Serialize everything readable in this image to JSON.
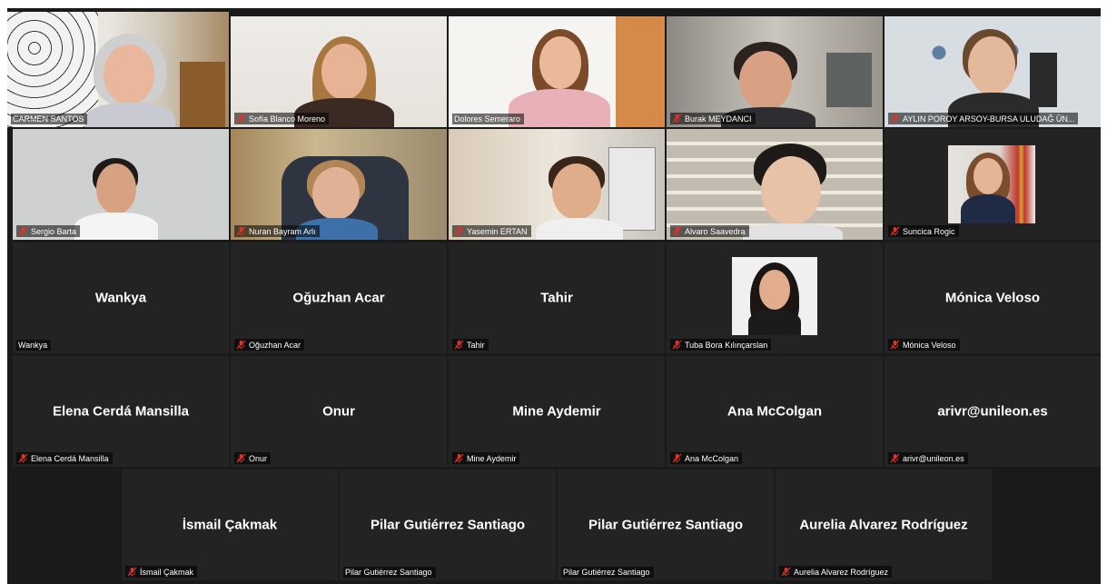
{
  "participants": [
    {
      "name": "CARMEN SANTOS",
      "muted": false,
      "video": true,
      "active": true
    },
    {
      "name": "Sofía Blanco Moreno",
      "muted": true,
      "video": true
    },
    {
      "name": "Dolores Semeraro",
      "muted": false,
      "video": true
    },
    {
      "name": "Burak MEYDANCI",
      "muted": true,
      "video": true
    },
    {
      "name": "AYLIN POROY ARSOY-BURSA ULUDAĞ ÜN...",
      "muted": true,
      "video": true
    },
    {
      "name": "Sergio Barta",
      "muted": true,
      "video": true
    },
    {
      "name": "Nuran Bayram Arlı",
      "muted": true,
      "video": true
    },
    {
      "name": "Yasemin ERTAN",
      "muted": true,
      "video": true
    },
    {
      "name": "Alvaro Saavedra",
      "muted": true,
      "video": true
    },
    {
      "name": "Suncica Rogic",
      "muted": true,
      "video": true
    },
    {
      "name": "Wankya",
      "display": "Wankya",
      "muted": false,
      "video": false
    },
    {
      "name": "Oğuzhan Acar",
      "display": "Oğuzhan Acar",
      "muted": true,
      "video": false
    },
    {
      "name": "Tahir",
      "display": "Tahir",
      "muted": true,
      "video": false
    },
    {
      "name": "Tuba Bora Kılınçarslan",
      "muted": true,
      "video": false,
      "photo": true
    },
    {
      "name": "Mónica Veloso",
      "display": "Mónica Veloso",
      "muted": true,
      "video": false
    },
    {
      "name": "Elena Cerdá Mansilla",
      "display": "Elena Cerdá Mansilla",
      "muted": true,
      "video": false
    },
    {
      "name": "Onur",
      "display": "Onur",
      "muted": true,
      "video": false
    },
    {
      "name": "Mine Aydemir",
      "display": "Mine Aydemir",
      "muted": true,
      "video": false
    },
    {
      "name": "Ana McColgan",
      "display": "Ana McColgan",
      "muted": true,
      "video": false
    },
    {
      "name": "arivr@unileon.es",
      "display": "arivr@unileon.es",
      "muted": true,
      "video": false
    },
    {
      "name": "İsmail Çakmak",
      "display": "İsmail Çakmak",
      "muted": true,
      "video": false
    },
    {
      "name": "Pilar Gutiérrez Santiago",
      "display": "Pilar Gutiérrez Santiago",
      "muted": false,
      "video": false
    },
    {
      "name": "Pilar Gutiérrez Santiago",
      "display": "Pilar Gutiérrez Santiago",
      "muted": false,
      "video": false
    },
    {
      "name": "Aurelia Alvarez Rodríguez",
      "display": "Aurelia Alvarez Rodríguez",
      "muted": true,
      "video": false
    }
  ],
  "colors": {
    "active_border": "#b5d04a",
    "mute_icon": "#e0302a",
    "tile_bg": "#232323",
    "stage_bg": "#1a1a1a"
  },
  "icons": {
    "mute": "microphone-muted-icon"
  }
}
